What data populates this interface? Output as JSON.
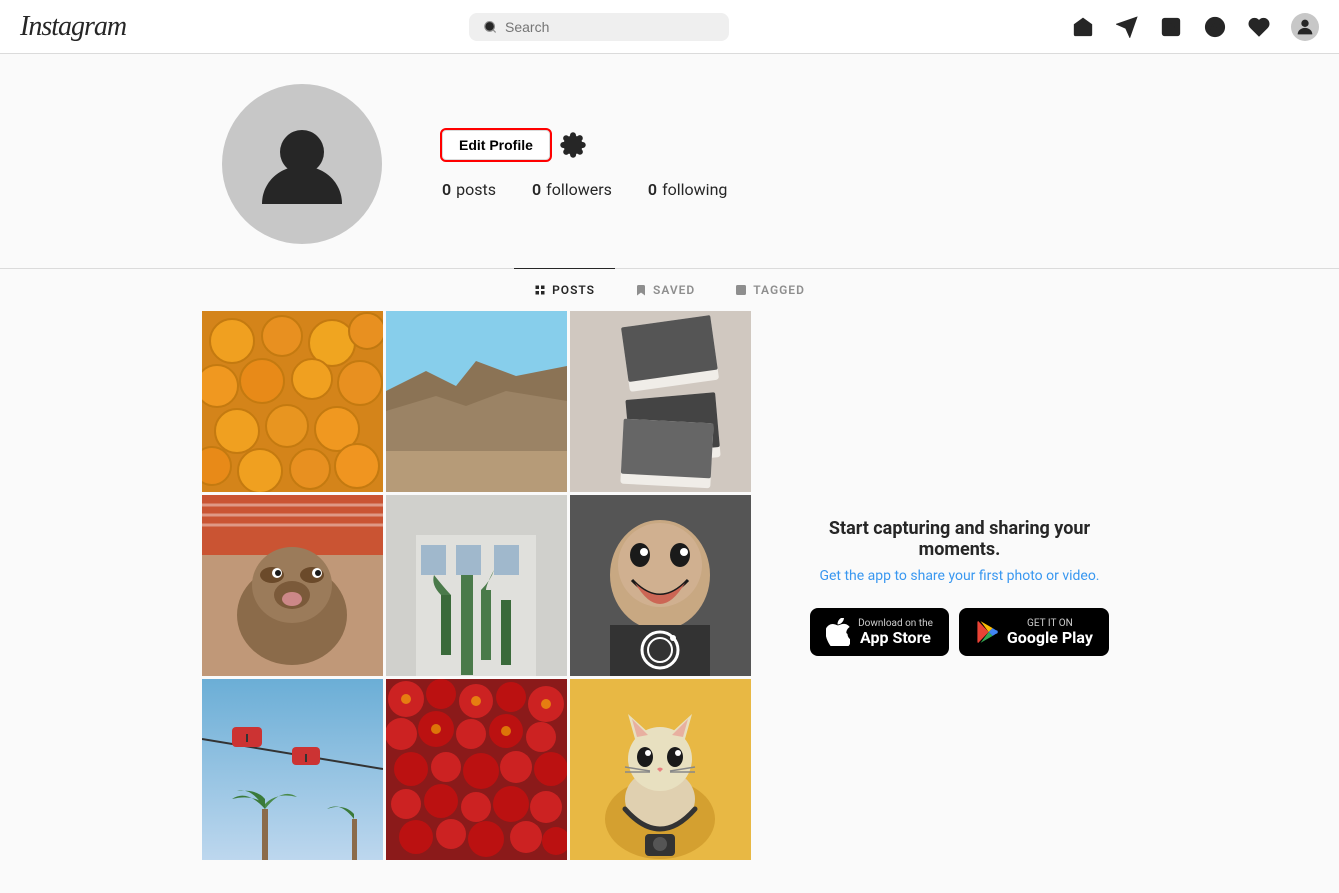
{
  "header": {
    "logo": "Instagram",
    "search_placeholder": "Search",
    "icons": [
      "home",
      "direct",
      "new-post",
      "explore",
      "activity",
      "profile"
    ]
  },
  "profile": {
    "posts_count": "0",
    "posts_label": "posts",
    "followers_count": "0",
    "followers_label": "followers",
    "following_count": "0",
    "following_label": "following",
    "edit_profile_label": "Edit Profile"
  },
  "tabs": [
    {
      "id": "posts",
      "label": "POSTS",
      "active": true
    },
    {
      "id": "saved",
      "label": "SAVED",
      "active": false
    },
    {
      "id": "tagged",
      "label": "TAGGED",
      "active": false
    }
  ],
  "app_section": {
    "title": "Start capturing and sharing your moments.",
    "subtitle": "Get the app to share your first photo or video.",
    "app_store_label": "Download on the",
    "app_store_name": "App Store",
    "google_play_label": "GET IT ON",
    "google_play_name": "Google Play"
  }
}
